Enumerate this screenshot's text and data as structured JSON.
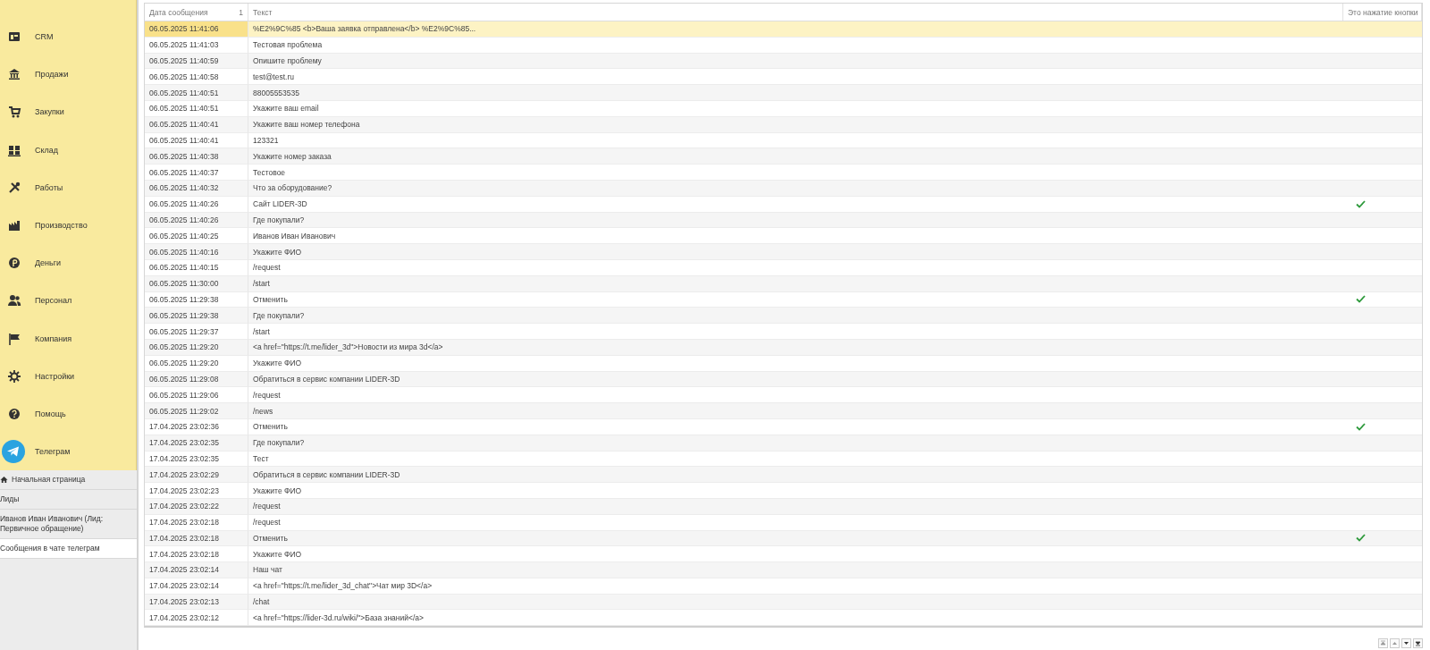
{
  "sidebar": {
    "items": [
      {
        "label": "CRM"
      },
      {
        "label": "Продажи"
      },
      {
        "label": "Закупки"
      },
      {
        "label": "Склад"
      },
      {
        "label": "Работы"
      },
      {
        "label": "Производство"
      },
      {
        "label": "Деньги"
      },
      {
        "label": "Персонал"
      },
      {
        "label": "Компания"
      },
      {
        "label": "Настройки"
      },
      {
        "label": "Помощь"
      },
      {
        "label": "Телеграм"
      }
    ]
  },
  "open_pages": [
    {
      "label": "Начальная страница",
      "selected": false
    },
    {
      "label": "Лиды",
      "selected": false
    },
    {
      "label": "Иванов Иван Иванович (Лид: Первичное обращение)",
      "selected": false
    },
    {
      "label": "Сообщения в чате телеграм",
      "selected": true
    }
  ],
  "table": {
    "columns": [
      {
        "label": "Дата сообщения",
        "sort": "1"
      },
      {
        "label": "Текст"
      },
      {
        "label": "Это нажатие кнопки"
      }
    ],
    "rows": [
      {
        "date": "06.05.2025 11:41:06",
        "text": "%E2%9C%85 <b>Ваша заявка отправлена</b> %E2%9C%85...",
        "button_press": false,
        "selected": true
      },
      {
        "date": "06.05.2025 11:41:03",
        "text": "Тестовая проблема",
        "button_press": false,
        "selected": false
      },
      {
        "date": "06.05.2025 11:40:59",
        "text": "Опишите проблему",
        "button_press": false,
        "selected": false
      },
      {
        "date": "06.05.2025 11:40:58",
        "text": "test@test.ru",
        "button_press": false,
        "selected": false
      },
      {
        "date": "06.05.2025 11:40:51",
        "text": "88005553535",
        "button_press": false,
        "selected": false
      },
      {
        "date": "06.05.2025 11:40:51",
        "text": "Укажите ваш email",
        "button_press": false,
        "selected": false
      },
      {
        "date": "06.05.2025 11:40:41",
        "text": "Укажите ваш номер телефона",
        "button_press": false,
        "selected": false
      },
      {
        "date": "06.05.2025 11:40:41",
        "text": "123321",
        "button_press": false,
        "selected": false
      },
      {
        "date": "06.05.2025 11:40:38",
        "text": "Укажите номер заказа",
        "button_press": false,
        "selected": false
      },
      {
        "date": "06.05.2025 11:40:37",
        "text": "Тестовое",
        "button_press": false,
        "selected": false
      },
      {
        "date": "06.05.2025 11:40:32",
        "text": "Что за оборудование?",
        "button_press": false,
        "selected": false
      },
      {
        "date": "06.05.2025 11:40:26",
        "text": "Сайт LIDER-3D",
        "button_press": true,
        "selected": false
      },
      {
        "date": "06.05.2025 11:40:26",
        "text": "Где покупали?",
        "button_press": false,
        "selected": false
      },
      {
        "date": "06.05.2025 11:40:25",
        "text": "Иванов Иван Иванович",
        "button_press": false,
        "selected": false
      },
      {
        "date": "06.05.2025 11:40:16",
        "text": "Укажите ФИО",
        "button_press": false,
        "selected": false
      },
      {
        "date": "06.05.2025 11:40:15",
        "text": "/request",
        "button_press": false,
        "selected": false
      },
      {
        "date": "06.05.2025 11:30:00",
        "text": "/start",
        "button_press": false,
        "selected": false
      },
      {
        "date": "06.05.2025 11:29:38",
        "text": "Отменить",
        "button_press": true,
        "selected": false
      },
      {
        "date": "06.05.2025 11:29:38",
        "text": "Где покупали?",
        "button_press": false,
        "selected": false
      },
      {
        "date": "06.05.2025 11:29:37",
        "text": "/start",
        "button_press": false,
        "selected": false
      },
      {
        "date": "06.05.2025 11:29:20",
        "text": "<a href=\"https://t.me/lider_3d\">Новости из мира 3d</a>",
        "button_press": false,
        "selected": false
      },
      {
        "date": "06.05.2025 11:29:20",
        "text": "Укажите ФИО",
        "button_press": false,
        "selected": false
      },
      {
        "date": "06.05.2025 11:29:08",
        "text": "Обратиться в сервис компании LIDER-3D",
        "button_press": false,
        "selected": false
      },
      {
        "date": "06.05.2025 11:29:06",
        "text": "/request",
        "button_press": false,
        "selected": false
      },
      {
        "date": "06.05.2025 11:29:02",
        "text": "/news",
        "button_press": false,
        "selected": false
      },
      {
        "date": "17.04.2025 23:02:36",
        "text": "Отменить",
        "button_press": true,
        "selected": false
      },
      {
        "date": "17.04.2025 23:02:35",
        "text": "Где покупали?",
        "button_press": false,
        "selected": false
      },
      {
        "date": "17.04.2025 23:02:35",
        "text": "Тест",
        "button_press": false,
        "selected": false
      },
      {
        "date": "17.04.2025 23:02:29",
        "text": "Обратиться в сервис компании LIDER-3D",
        "button_press": false,
        "selected": false
      },
      {
        "date": "17.04.2025 23:02:23",
        "text": "Укажите ФИО",
        "button_press": false,
        "selected": false
      },
      {
        "date": "17.04.2025 23:02:22",
        "text": "/request",
        "button_press": false,
        "selected": false
      },
      {
        "date": "17.04.2025 23:02:18",
        "text": "/request",
        "button_press": false,
        "selected": false
      },
      {
        "date": "17.04.2025 23:02:18",
        "text": "Отменить",
        "button_press": true,
        "selected": false
      },
      {
        "date": "17.04.2025 23:02:18",
        "text": "Укажите ФИО",
        "button_press": false,
        "selected": false
      },
      {
        "date": "17.04.2025 23:02:14",
        "text": "Наш чат",
        "button_press": false,
        "selected": false
      },
      {
        "date": "17.04.2025 23:02:14",
        "text": "<a href=\"https://t.me/lider_3d_chat\">Чат мир 3D</a>",
        "button_press": false,
        "selected": false
      },
      {
        "date": "17.04.2025 23:02:13",
        "text": "/chat",
        "button_press": false,
        "selected": false
      },
      {
        "date": "17.04.2025 23:02:12",
        "text": "<a href=\"https://lider-3d.ru/wiki/\">База знаний</a>",
        "button_press": false,
        "selected": false
      }
    ]
  }
}
